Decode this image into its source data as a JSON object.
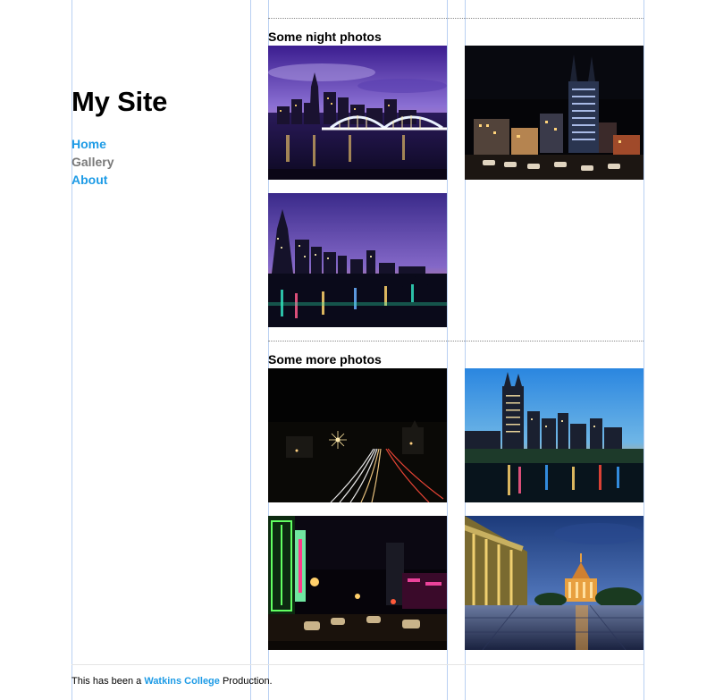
{
  "site": {
    "title": "My Site"
  },
  "nav": [
    {
      "label": "Home"
    },
    {
      "label": "Gallery"
    },
    {
      "label": "About"
    }
  ],
  "sections": [
    {
      "heading": "Some night photos",
      "photos": [
        "nashville-skyline-bridge-dusk",
        "batman-building-night",
        "skyline-river-purple-sky"
      ]
    },
    {
      "heading": "Some more photos",
      "photos": [
        "light-trails-highway-night",
        "skyline-river-reflection-blue-hour",
        "broadway-neon-street",
        "capitol-plaza-rain-reflection"
      ]
    }
  ],
  "footer": {
    "prefix": "This has been a",
    "link": "Watkins College",
    "suffix": "Production."
  },
  "colors": {
    "link": "#1d9be6",
    "current_nav": "#7a7a7a",
    "guide": "#b9d0f2"
  }
}
